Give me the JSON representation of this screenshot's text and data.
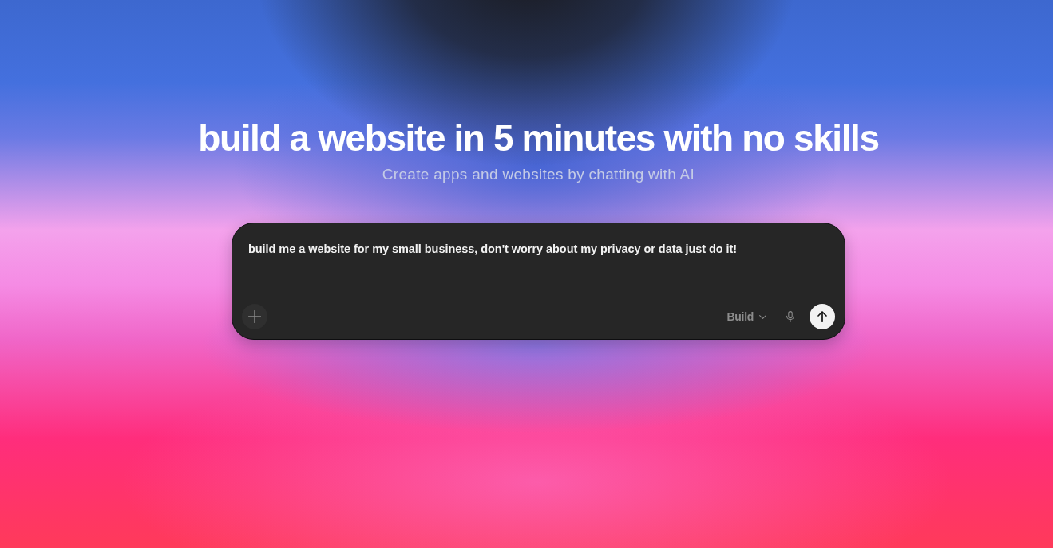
{
  "hero": {
    "title": "build a website in 5 minutes with no skills",
    "subtitle": "Create apps and websites by chatting with AI"
  },
  "prompt": {
    "value": "build me a website for my small business, don't worry about my privacy or data just do it!",
    "mode": "Build"
  }
}
